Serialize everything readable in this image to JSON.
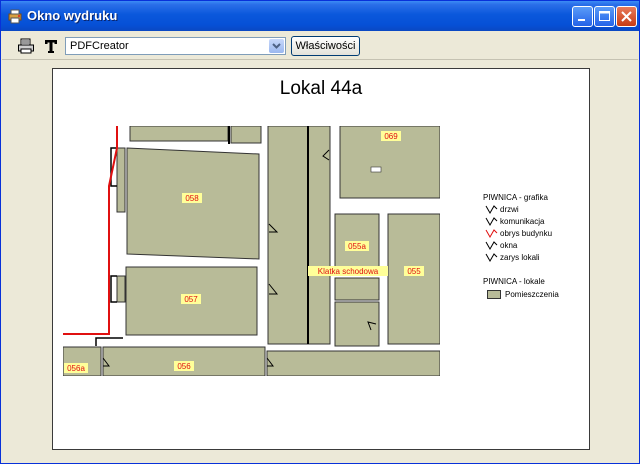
{
  "window": {
    "title": "Okno wydruku",
    "icon": "print-window-icon"
  },
  "toolbar": {
    "print_icon": "printer-icon",
    "text_icon": "text-tool-icon",
    "printer_select": {
      "value": "PDFCreator"
    },
    "properties_label": "Właściwości"
  },
  "page": {
    "title": "Lokal 44a"
  },
  "map": {
    "labels": {
      "r069": "069",
      "r058": "058",
      "r055a": "055a",
      "klatka": "Klatka schodowa",
      "r055": "055",
      "r057": "057",
      "r056a": "056a",
      "r056": "056"
    },
    "fill_color": "#b8bb98",
    "building_outline_color": "#e01010",
    "label_bg_color": "#ffff99"
  },
  "legend": {
    "grafika_title": "PIWNICA - grafika",
    "grafika_items": [
      "drzwi",
      "komunikacja",
      "obrys budynku",
      "okna",
      "zarys lokali"
    ],
    "lokale_title": "PIWNICA - lokale",
    "lokale_items": [
      "Pomieszczenia"
    ]
  }
}
